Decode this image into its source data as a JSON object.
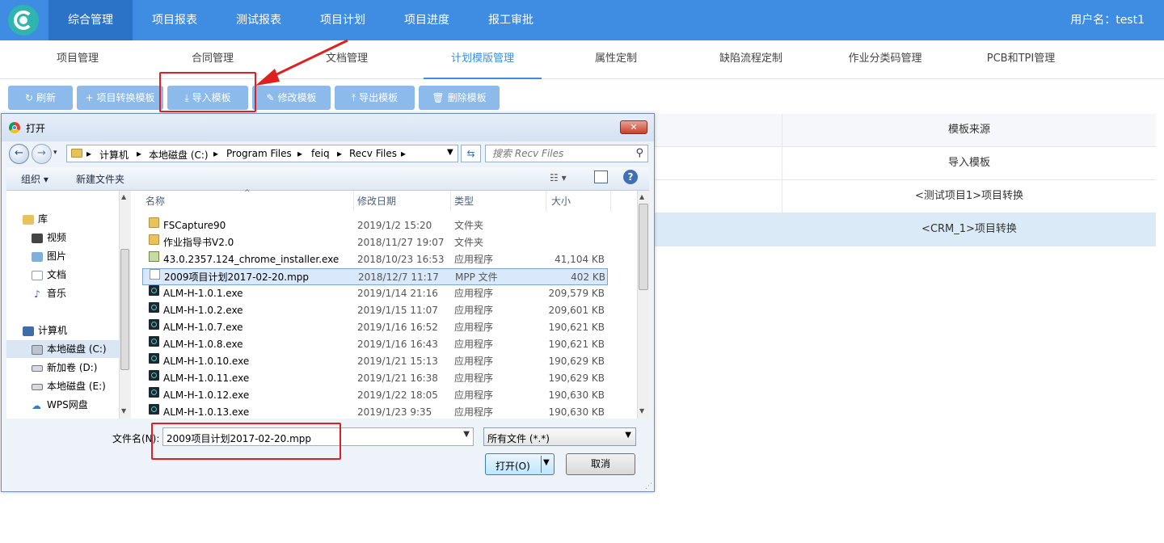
{
  "app": {
    "nav": [
      "综合管理",
      "项目报表",
      "测试报表",
      "项目计划",
      "项目进度",
      "报工审批"
    ],
    "active_nav": 0,
    "username": "用户名：test1"
  },
  "subnav": {
    "tabs": [
      "项目管理",
      "合同管理",
      "文档管理",
      "计划模版管理",
      "属性定制",
      "缺陷流程定制",
      "作业分类码管理",
      "PCB和TPI管理"
    ],
    "active_tab": 3
  },
  "toolbar": {
    "refresh": "刷新",
    "convert": "项目转换模板",
    "import": "导入模板",
    "edit": "修改模板",
    "export": "导出模板",
    "delete": "删除模板"
  },
  "bg_table": {
    "header": "模板来源",
    "rows": [
      "导入模板",
      "<测试项目1>项目转换",
      "<CRM_1>项目转换"
    ],
    "selected_row": 2
  },
  "dialog": {
    "title": "打开",
    "close": "✕",
    "breadcrumb": [
      "计算机",
      "本地磁盘 (C:)",
      "Program Files",
      "feiq",
      "Recv Files"
    ],
    "search_placeholder": "搜索 Recv Files",
    "organize": "组织 ▾",
    "new_folder": "新建文件夹",
    "nav_items": [
      {
        "label": "库",
        "icon": "library-icon"
      },
      {
        "label": "视频",
        "icon": "video-icon"
      },
      {
        "label": "图片",
        "icon": "picture-icon"
      },
      {
        "label": "文档",
        "icon": "document-icon"
      },
      {
        "label": "音乐",
        "icon": "music-icon"
      },
      {
        "label": "计算机",
        "icon": "computer-icon"
      },
      {
        "label": "本地磁盘 (C:)",
        "icon": "drive-icon"
      },
      {
        "label": "新加卷 (D:)",
        "icon": "drive-icon"
      },
      {
        "label": "本地磁盘 (E:)",
        "icon": "drive-icon"
      },
      {
        "label": "WPS网盘",
        "icon": "cloud-icon"
      }
    ],
    "columns": {
      "name": "名称",
      "date": "修改日期",
      "type": "类型",
      "size": "大小"
    },
    "files": [
      {
        "name": "FSCapture90",
        "date": "2019/1/2 15:20",
        "type": "文件夹",
        "size": "",
        "icon": "folder"
      },
      {
        "name": "作业指导书V2.0",
        "date": "2018/11/27 19:07",
        "type": "文件夹",
        "size": "",
        "icon": "folder"
      },
      {
        "name": "43.0.2357.124_chrome_installer.exe",
        "date": "2018/10/23 16:53",
        "type": "应用程序",
        "size": "41,104 KB",
        "icon": "inst"
      },
      {
        "name": "2009项目计划2017-02-20.mpp",
        "date": "2018/12/7 11:17",
        "type": "MPP 文件",
        "size": "402 KB",
        "icon": "doc"
      },
      {
        "name": "ALM-H-1.0.1.exe",
        "date": "2019/1/14 21:16",
        "type": "应用程序",
        "size": "209,579 KB",
        "icon": "exe"
      },
      {
        "name": "ALM-H-1.0.2.exe",
        "date": "2019/1/15 11:07",
        "type": "应用程序",
        "size": "209,601 KB",
        "icon": "exe"
      },
      {
        "name": "ALM-H-1.0.7.exe",
        "date": "2019/1/16 16:52",
        "type": "应用程序",
        "size": "190,621 KB",
        "icon": "exe"
      },
      {
        "name": "ALM-H-1.0.8.exe",
        "date": "2019/1/16 16:43",
        "type": "应用程序",
        "size": "190,621 KB",
        "icon": "exe"
      },
      {
        "name": "ALM-H-1.0.10.exe",
        "date": "2019/1/21 15:13",
        "type": "应用程序",
        "size": "190,629 KB",
        "icon": "exe"
      },
      {
        "name": "ALM-H-1.0.11.exe",
        "date": "2019/1/21 16:38",
        "type": "应用程序",
        "size": "190,629 KB",
        "icon": "exe"
      },
      {
        "name": "ALM-H-1.0.12.exe",
        "date": "2019/1/22 18:05",
        "type": "应用程序",
        "size": "190,630 KB",
        "icon": "exe"
      },
      {
        "name": "ALM-H-1.0.13.exe",
        "date": "2019/1/23 9:35",
        "type": "应用程序",
        "size": "190,630 KB",
        "icon": "exe"
      }
    ],
    "selected_file": 3,
    "filename_label": "文件名(N):",
    "filename_value": "2009项目计划2017-02-20.mpp",
    "filetype_value": "所有文件 (*.*)",
    "open_label": "打开(O)",
    "cancel_label": "取消"
  },
  "colors": {
    "primary": "#3e8de3",
    "nav_active": "#2a73c6",
    "button": "#8bbaeb",
    "highlight": "#e02020"
  }
}
